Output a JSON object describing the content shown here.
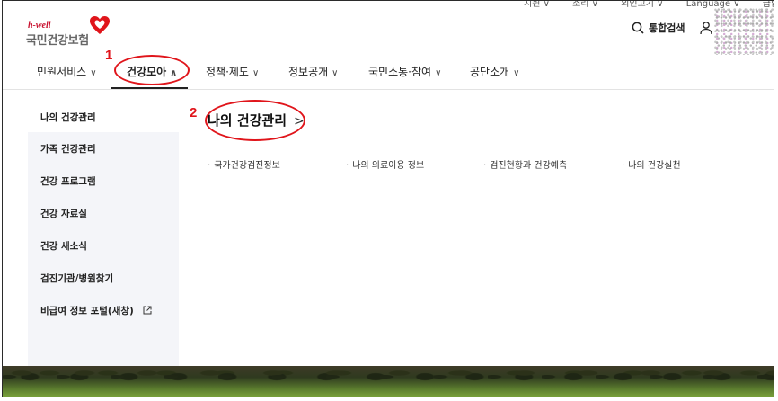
{
  "utility_bar": [
    "지원 ∨",
    "소리 ∨",
    "외인고기 ∨",
    "Language ∨",
    "급합 전각 ∧"
  ],
  "logo": {
    "tagline": "h-well",
    "name": "국민건강보험"
  },
  "header": {
    "search_label": "통합검색"
  },
  "gnb": {
    "items": [
      {
        "label": "민원서비스",
        "chevron": "∨"
      },
      {
        "label": "건강모아",
        "chevron": "∧"
      },
      {
        "label": "정책·제도",
        "chevron": "∨"
      },
      {
        "label": "정보공개",
        "chevron": "∨"
      },
      {
        "label": "국민소통·참여",
        "chevron": "∨"
      },
      {
        "label": "공단소개",
        "chevron": "∨"
      }
    ]
  },
  "annotations": {
    "badge1": "1",
    "badge2": "2",
    "color": "#e0151b"
  },
  "sidebar": {
    "items": [
      {
        "label": "나의 건강관리"
      },
      {
        "label": "가족 건강관리"
      },
      {
        "label": "건강 프로그램"
      },
      {
        "label": "건강 자료실"
      },
      {
        "label": "건강 새소식"
      },
      {
        "label": "검진기관/병원찾기"
      },
      {
        "label": "비급여 정보 포털(새창)",
        "external": true
      }
    ]
  },
  "content": {
    "title": "나의 건강관리",
    "arrow": ">",
    "links": [
      "국가건강검진정보",
      "나의 의료이용 정보",
      "검진현황과 건강예측",
      "나의 건강실천"
    ]
  },
  "colors": {
    "sidebar_bg": "#f4f5f9",
    "brand_red": "#c8102e"
  }
}
